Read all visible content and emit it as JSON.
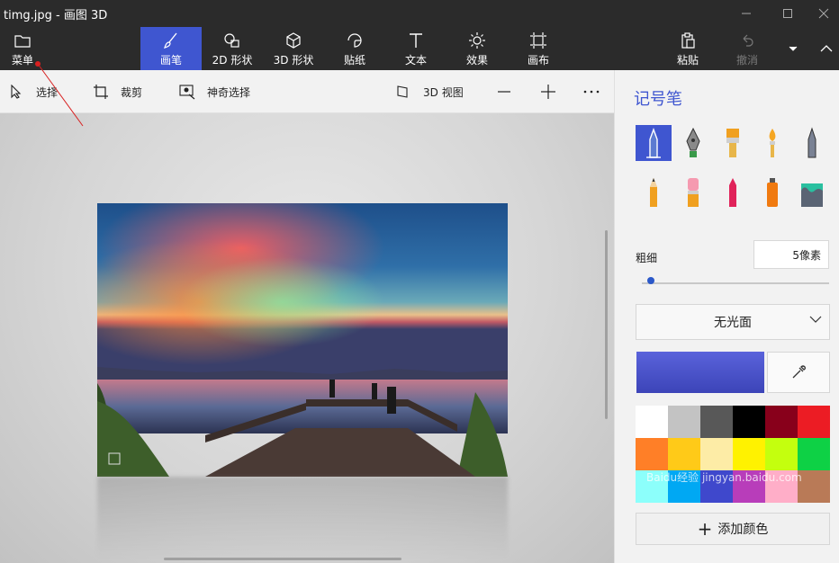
{
  "window": {
    "title": "timg.jpg - 画图 3D"
  },
  "ribbon": {
    "menu_label": "菜单",
    "tools": [
      {
        "label": "画笔"
      },
      {
        "label": "2D 形状"
      },
      {
        "label": "3D 形状"
      },
      {
        "label": "贴纸"
      },
      {
        "label": "文本"
      },
      {
        "label": "效果"
      },
      {
        "label": "画布"
      }
    ],
    "paste_label": "粘贴",
    "undo_label": "撤消"
  },
  "toolbar": {
    "select_label": "选择",
    "crop_label": "裁剪",
    "magic_select_label": "神奇选择",
    "view3d_label": "3D 视图"
  },
  "panel": {
    "title": "记号笔",
    "thickness_label": "粗细",
    "thickness_value": "5像素",
    "thickness_fraction": 0.03,
    "finish_value": "无光面",
    "current_color": "#3c44b8",
    "add_color_label": "添加颜色",
    "brushes": [
      "marker",
      "calligraphy-pen",
      "oil-brush",
      "watercolor",
      "pixel-pen",
      "pencil",
      "eraser",
      "crayon",
      "spray-can",
      "fill"
    ],
    "palette": [
      "#ffffff",
      "#c3c3c3",
      "#585858",
      "#000000",
      "#88001b",
      "#ec1c24",
      "#ff7f27",
      "#ffca18",
      "#fdeca6",
      "#fff200",
      "#c4ff0e",
      "#0ed145",
      "#8cfffb",
      "#00a8f3",
      "#3f48cc",
      "#b83dba",
      "#ffaec8",
      "#b97a57"
    ]
  },
  "watermark": "Baidu经验 jingyan.baidu.com"
}
